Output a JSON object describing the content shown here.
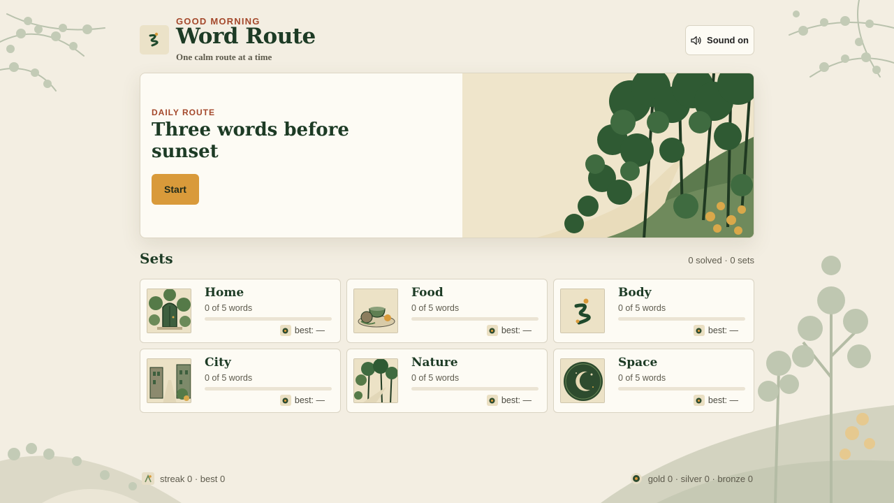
{
  "header": {
    "greeting": "GOOD MORNING",
    "title": "Word Route",
    "tagline": "One calm route at a time",
    "sound_label": "Sound on"
  },
  "hero": {
    "kicker": "DAILY ROUTE",
    "heading": "Three words before sunset",
    "start_label": "Start"
  },
  "sets": {
    "title": "Sets",
    "summary": "0 solved · 0 sets",
    "items": [
      {
        "name": "Home",
        "progress": "0 of 5 words",
        "best": "best: —",
        "fill": 0,
        "thumb": "door-icon"
      },
      {
        "name": "Food",
        "progress": "0 of 5 words",
        "best": "best: —",
        "fill": 0,
        "thumb": "bowl-icon"
      },
      {
        "name": "Body",
        "progress": "0 of 5 words",
        "best": "best: —",
        "fill": 0,
        "thumb": "figure-icon"
      },
      {
        "name": "City",
        "progress": "0 of 5 words",
        "best": "best: —",
        "fill": 0,
        "thumb": "street-icon"
      },
      {
        "name": "Nature",
        "progress": "0 of 5 words",
        "best": "best: —",
        "fill": 0,
        "thumb": "forest-icon"
      },
      {
        "name": "Space",
        "progress": "0 of 5 words",
        "best": "best: —",
        "fill": 0,
        "thumb": "moon-icon"
      }
    ]
  },
  "footer": {
    "streak": "streak 0 · best 0",
    "medals": "gold 0 · silver 0 · bronze 0"
  },
  "colors": {
    "accent": "#a4482b",
    "brand": "#1d3b25",
    "button": "#d99a3a",
    "background": "#f3eee2"
  }
}
